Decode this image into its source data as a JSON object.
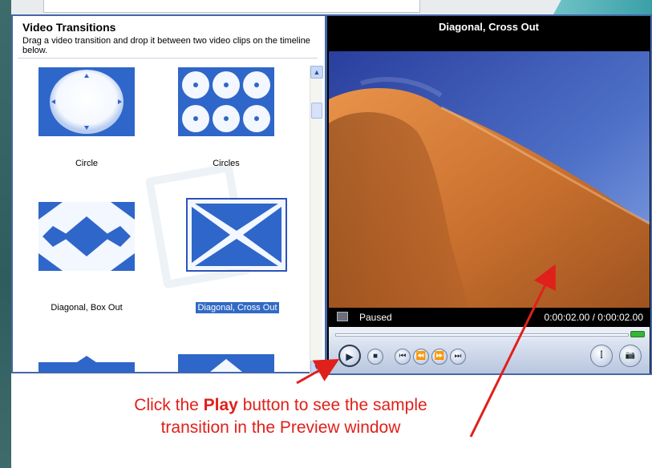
{
  "transitions_panel": {
    "title": "Video Transitions",
    "description": "Drag a video transition and drop it between two video clips on the timeline below.",
    "items": [
      {
        "label": "Circle",
        "icon": "circle-transition-icon"
      },
      {
        "label": "Circles",
        "icon": "circles-transition-icon"
      },
      {
        "label": "Diagonal, Box Out",
        "icon": "diagonal-box-out-icon"
      },
      {
        "label": "Diagonal, Cross Out",
        "icon": "diagonal-cross-out-icon",
        "selected": true
      }
    ],
    "scroll_up_icon": "▲",
    "scroll_down_icon": "▼"
  },
  "preview": {
    "title": "Diagonal, Cross Out",
    "status": "Paused",
    "time": "0:00:02.00 / 0:00:02.00"
  },
  "controls": {
    "play_icon": "▶",
    "stop_icon": "■",
    "prev_icon": "⏮",
    "rewind_icon": "⏪",
    "forward_icon": "⏩",
    "next_icon": "⏭",
    "split_icon": "⫿",
    "snapshot_icon": "📷"
  },
  "annotation": {
    "line1_pre": "Click the ",
    "line1_bold": "Play",
    "line1_post": " button to see the sample",
    "line2": "transition in the Preview window"
  },
  "colors": {
    "accent_blue": "#4468a8",
    "selection_blue": "#316ac5",
    "annotation_red": "#e0201b",
    "tile_blue": "#2f66c9"
  }
}
